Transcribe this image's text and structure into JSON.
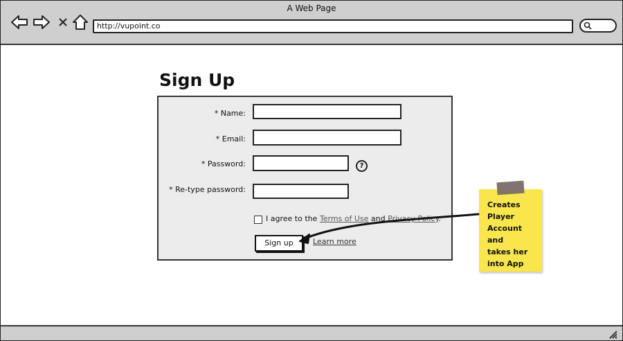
{
  "browser": {
    "window_title": "A Web Page",
    "url": "http://vupoint.co"
  },
  "form": {
    "title": "Sign Up",
    "fields": [
      {
        "label": "* Name:",
        "value": ""
      },
      {
        "label": "* Email:",
        "value": ""
      },
      {
        "label": "* Password:",
        "value": ""
      },
      {
        "label": "* Re-type password:",
        "value": ""
      }
    ],
    "help_glyph": "?",
    "agree_prefix": "I agree to the",
    "terms_link": "Terms of Use",
    "agree_and": "and",
    "privacy_link": "Privacy Policy",
    "agree_suffix": ".",
    "submit_label": "Sign up",
    "learn_more": "Learn more"
  },
  "annotation": {
    "note_lines": [
      "Creates",
      "Player",
      "Account and",
      "takes her",
      "into App"
    ]
  }
}
